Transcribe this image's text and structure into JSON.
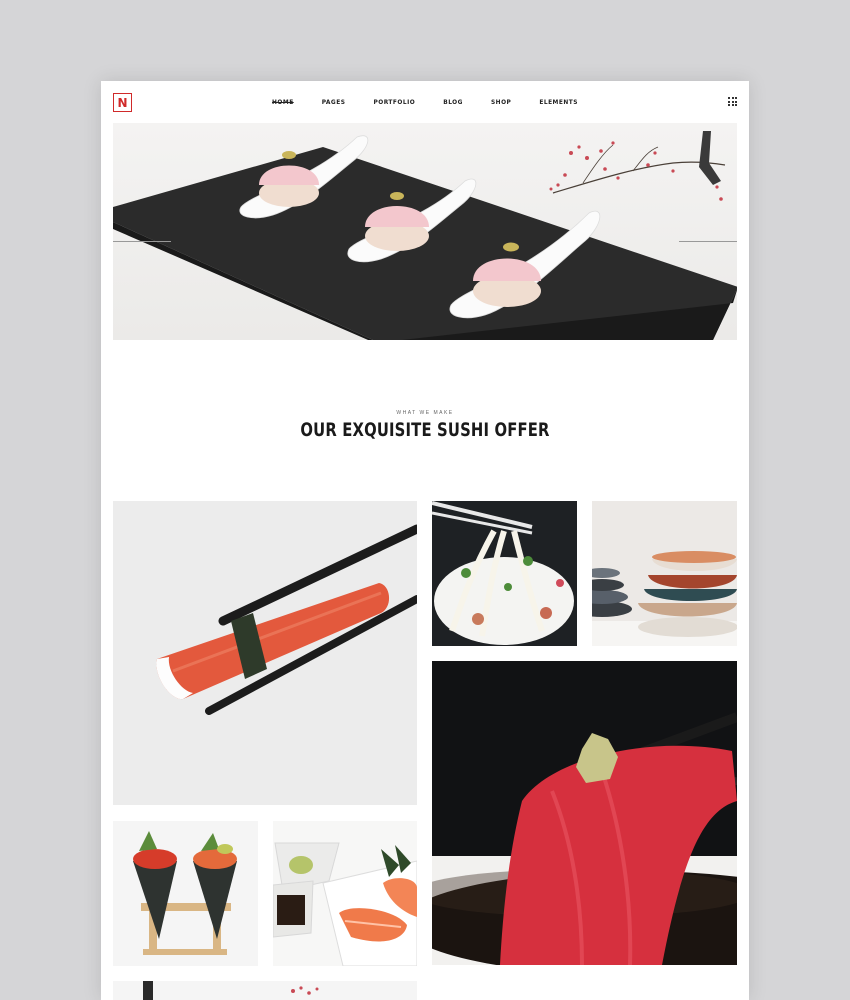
{
  "brand": {
    "logo_letter": "N",
    "accent": "#d02a2a"
  },
  "nav": {
    "items": [
      "HOME",
      "PAGES",
      "PORTFOLIO",
      "BLOG",
      "SHOP",
      "ELEMENTS"
    ],
    "active": "HOME"
  },
  "hero": {
    "image": "dessert-spoons-on-slate-with-cherry-blossom"
  },
  "section": {
    "eyebrow": "WHAT WE MAKE",
    "title": "OUR EXQUISITE SUSHI OFFER"
  },
  "gallery": [
    {
      "name": "crab-stick-with-chopsticks"
    },
    {
      "name": "udon-noodles"
    },
    {
      "name": "stacked-bowls"
    },
    {
      "name": "tuna-sashimi-with-wasabi"
    },
    {
      "name": "temaki-cones"
    },
    {
      "name": "salmon-nigiri-plate"
    }
  ],
  "colors": {
    "background": "#d5d5d7",
    "page": "#ffffff",
    "text": "#1a1a1a"
  }
}
